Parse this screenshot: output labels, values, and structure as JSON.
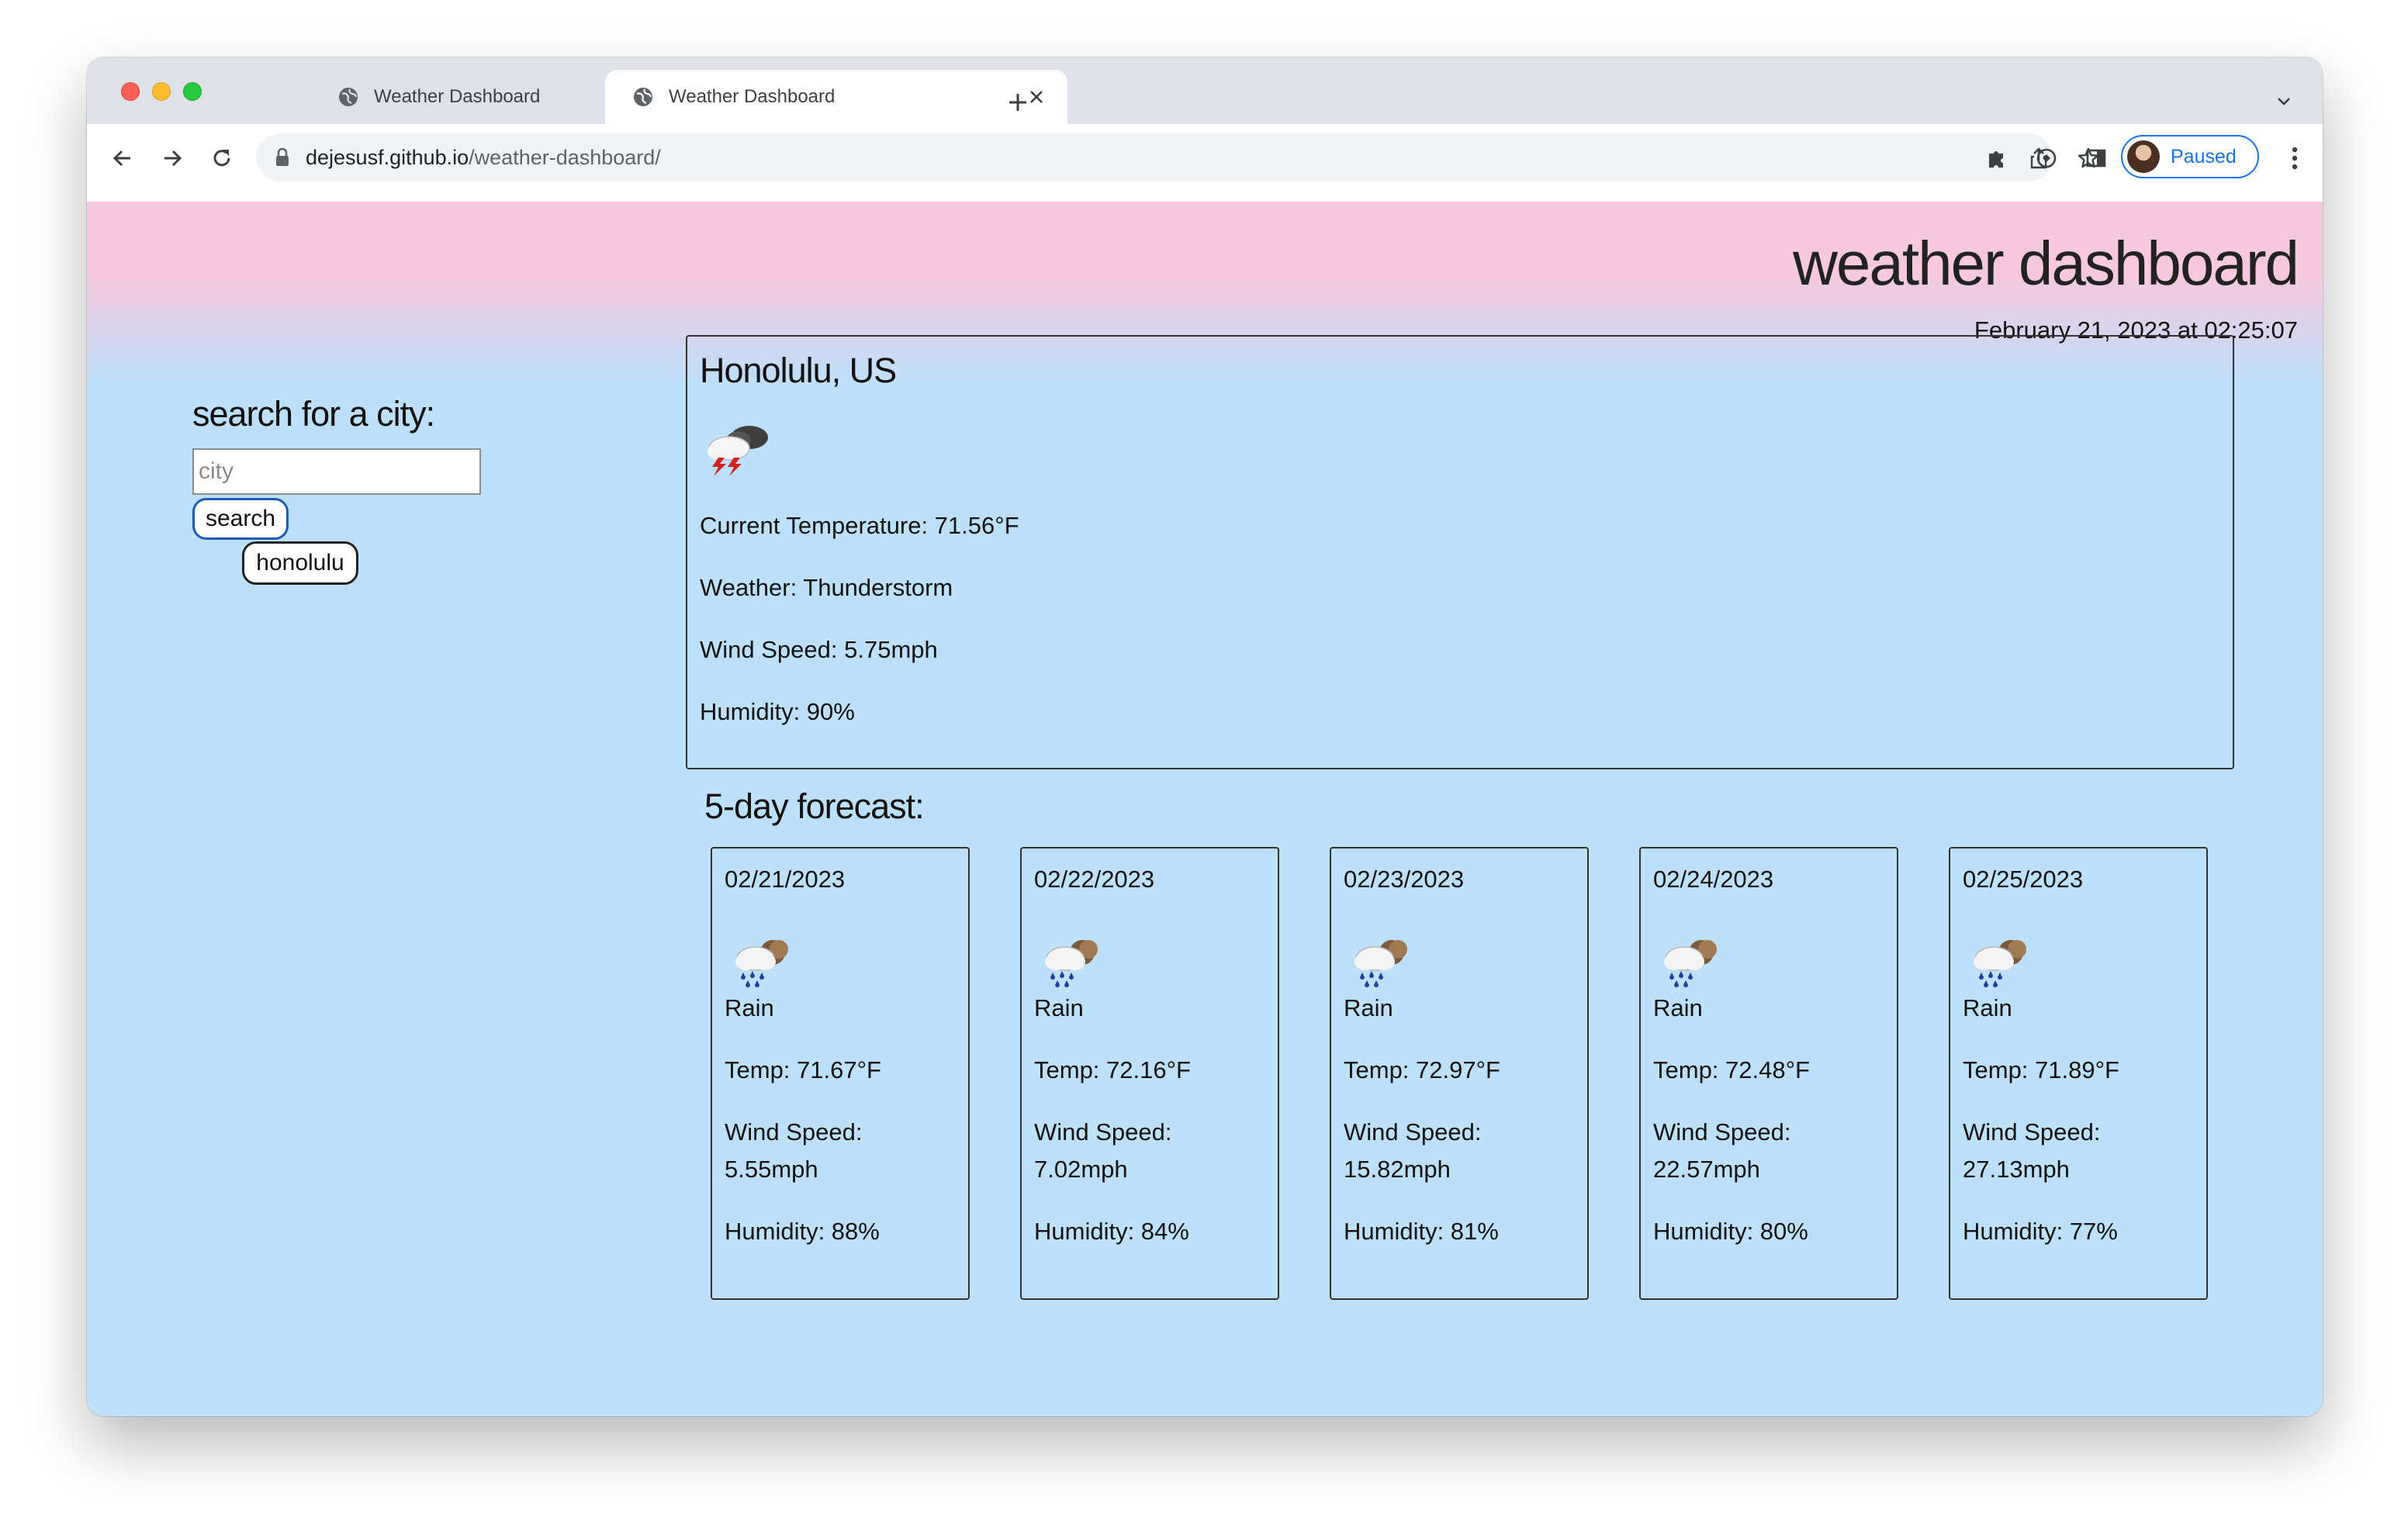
{
  "browser": {
    "tabs": [
      {
        "title": "Weather Dashboard",
        "active": false
      },
      {
        "title": "Weather Dashboard",
        "active": true
      }
    ],
    "url_host": "dejesusf.github.io",
    "url_path": "/weather-dashboard/",
    "profile_label": "Paused"
  },
  "header": {
    "title": "weather dashboard",
    "datetime": "February 21, 2023 at 02:25:07"
  },
  "search": {
    "heading": "search for a city:",
    "placeholder": "city",
    "button_label": "search",
    "history": [
      "honolulu"
    ]
  },
  "current": {
    "city": "Honolulu, US",
    "icon": "thunderstorm-icon",
    "temperature": "Current Temperature: 71.56°F",
    "weather": "Weather: Thunderstorm",
    "wind": "Wind Speed: 5.75mph",
    "humidity": "Humidity: 90%"
  },
  "forecast": {
    "heading": "5-day forecast:",
    "days": [
      {
        "date": "02/21/2023",
        "icon": "rain-icon",
        "condition": "Rain",
        "temp": "Temp: 71.67°F",
        "wind_label": "Wind Speed:",
        "wind_value": "5.55mph",
        "humidity": "Humidity: 88%"
      },
      {
        "date": "02/22/2023",
        "icon": "rain-icon",
        "condition": "Rain",
        "temp": "Temp: 72.16°F",
        "wind_label": "Wind Speed:",
        "wind_value": "7.02mph",
        "humidity": "Humidity: 84%"
      },
      {
        "date": "02/23/2023",
        "icon": "rain-icon",
        "condition": "Rain",
        "temp": "Temp: 72.97°F",
        "wind_label": "Wind Speed:",
        "wind_value": "15.82mph",
        "humidity": "Humidity: 81%"
      },
      {
        "date": "02/24/2023",
        "icon": "rain-icon",
        "condition": "Rain",
        "temp": "Temp: 72.48°F",
        "wind_label": "Wind Speed:",
        "wind_value": "22.57mph",
        "humidity": "Humidity: 80%"
      },
      {
        "date": "02/25/2023",
        "icon": "rain-icon",
        "condition": "Rain",
        "temp": "Temp: 71.89°F",
        "wind_label": "Wind Speed:",
        "wind_value": "27.13mph",
        "humidity": "Humidity: 77%"
      }
    ]
  },
  "colors": {
    "page_background": "#bde0fb",
    "header_pink": "#f8c8df",
    "search_button_border": "#1c5bb8"
  }
}
